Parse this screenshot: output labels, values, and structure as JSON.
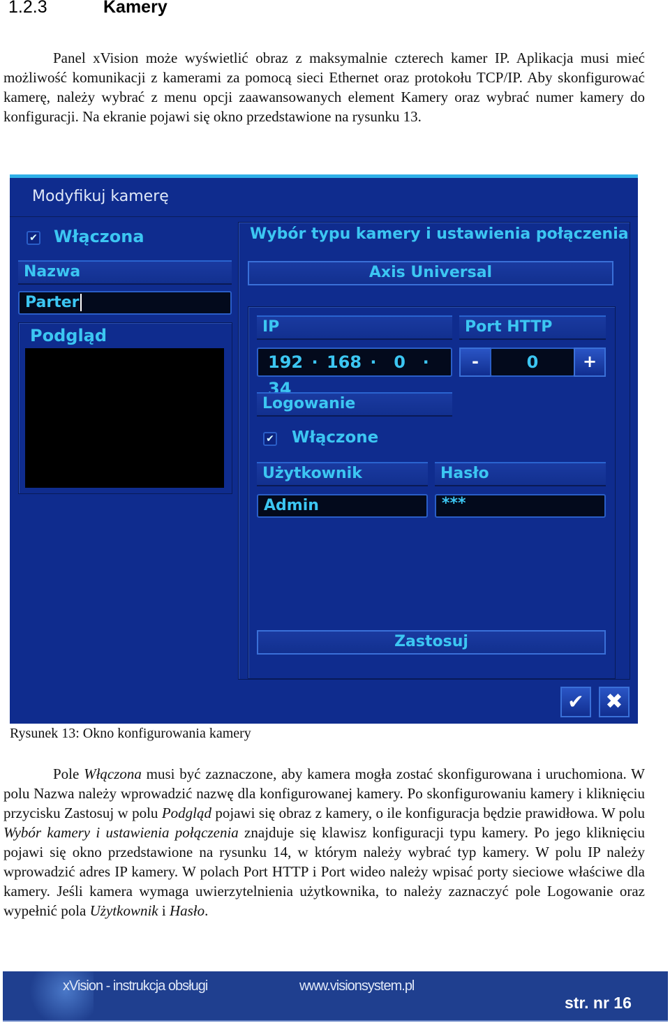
{
  "section": {
    "number": "1.2.3",
    "title": "Kamery"
  },
  "intro": "Panel xVision może wyświetlić obraz z maksymalnie czterech kamer IP. Aplikacja musi mieć możliwość komunikacji z kamerami za pomocą sieci Ethernet oraz protokołu TCP/IP. Aby skonfigurować kamerę, należy wybrać z menu opcji zaawansowanych element Kamery oraz wybrać numer kamery do konfiguracji. Na ekranie pojawi się okno przedstawione na rysunku 13.",
  "dialog": {
    "title": "Modyfikuj kamerę",
    "enabled_label": "Włączona",
    "enabled_checked": true,
    "name_label": "Nazwa",
    "name_value": "Parter",
    "preview_label": "Podgląd",
    "camera_type_section": "Wybór typu kamery i ustawienia połączenia",
    "camera_type_button": "Axis Universal",
    "ip_label": "IP",
    "ip_octets": [
      "192",
      "168",
      "0",
      "34"
    ],
    "port_label": "Port HTTP",
    "port_minus": "-",
    "port_value": "0",
    "port_plus": "+",
    "login_label": "Logowanie",
    "login_enabled_label": "Włączone",
    "login_enabled_checked": true,
    "user_label": "Użytkownik",
    "user_value": "Admin",
    "password_label": "Hasło",
    "password_value": "***",
    "apply_button": "Zastosuj",
    "ok_icon": "checkmark-icon",
    "cancel_icon": "close-icon",
    "colors": {
      "background": "#0f2c8e",
      "accent": "#3cc6f2",
      "field": "#030a1c"
    }
  },
  "caption": "Rysunek 13: Okno konfigurowania kamery",
  "body_segments": [
    {
      "t": "Pole ",
      "i": false
    },
    {
      "t": "Włączona",
      "i": true
    },
    {
      "t": " musi być zaznaczone, aby kamera mogła zostać skonfigurowana i uruchomiona. W polu Nazwa należy wprowadzić nazwę dla konfigurowanej kamery. Po skonfigurowaniu kamery i kliknięciu przycisku Zastosuj w polu ",
      "i": false
    },
    {
      "t": "Podgląd",
      "i": true
    },
    {
      "t": " pojawi się obraz z kamery, o ile konfiguracja będzie prawidłowa. W polu ",
      "i": false
    },
    {
      "t": "Wybór kamery i ustawienia połączenia",
      "i": true
    },
    {
      "t": " znajduje się klawisz konfiguracji typu kamery. Po jego kliknięciu pojawi się okno przedstawione na rysunku 14, w którym należy wybrać typ kamery. W polu IP należy wprowadzić adres IP kamery. W polach Port HTTP i Port wideo należy wpisać porty sieciowe właściwe dla kamery. Jeśli kamera wymaga uwierzytelnienia użytkownika, to należy zaznaczyć pole Logowanie oraz wypełnić pola ",
      "i": false
    },
    {
      "t": "Użytkownik",
      "i": true
    },
    {
      "t": " i ",
      "i": false
    },
    {
      "t": "Hasło",
      "i": true
    },
    {
      "t": ".",
      "i": false
    }
  ],
  "footer": {
    "manual": "xVision - instrukcja obsługi",
    "website": "www.visionsystem.pl",
    "page": "str. nr 16"
  }
}
